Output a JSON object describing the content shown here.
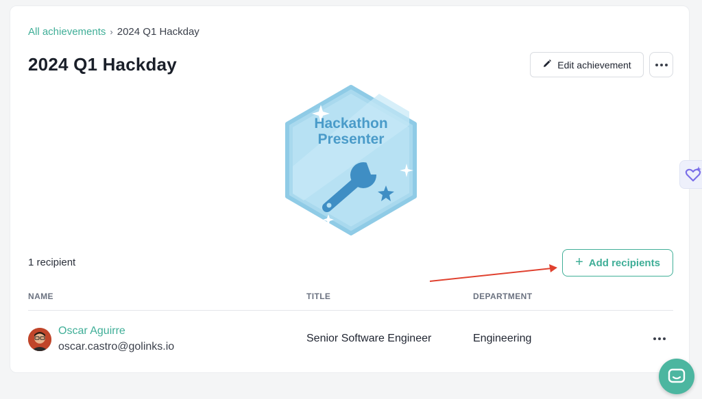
{
  "breadcrumb": {
    "link": "All achievements",
    "separator": "›",
    "current": "2024 Q1 Hackday"
  },
  "page": {
    "title": "2024 Q1 Hackday"
  },
  "actions": {
    "edit_label": "Edit achievement",
    "more_icon": "ellipsis-icon"
  },
  "badge": {
    "line1": "Hackathon",
    "line2": "Presenter",
    "icon": "wrench-icon"
  },
  "recipients": {
    "count_label": "1 recipient",
    "add_label": "Add recipients"
  },
  "table": {
    "headers": {
      "name": "NAME",
      "title": "TITLE",
      "department": "DEPARTMENT"
    },
    "rows": [
      {
        "name": "Oscar Aguirre",
        "email": "oscar.castro@golinks.io",
        "title": "Senior Software Engineer",
        "department": "Engineering"
      }
    ]
  },
  "colors": {
    "accent": "#3fae97",
    "annotation_arrow": "#e0402e",
    "badge_blue": "#4a9bc9"
  }
}
